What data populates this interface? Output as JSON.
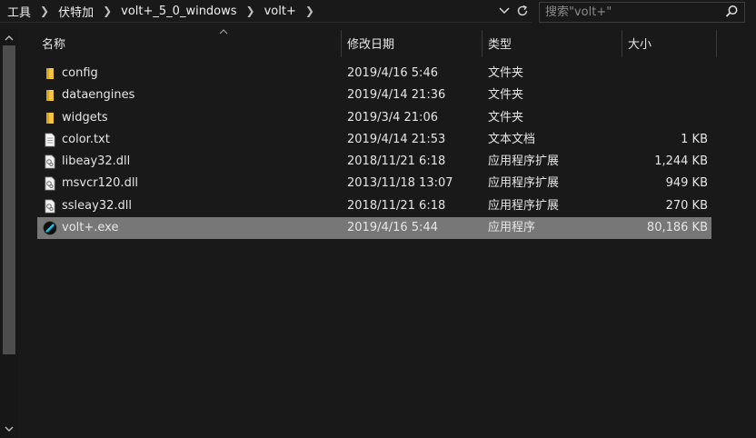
{
  "address": {
    "crumbs": [
      "工具",
      "伏特加",
      "volt+_5_0_windows",
      "volt+"
    ]
  },
  "search": {
    "placeholder": "搜索\"volt+\""
  },
  "columns": {
    "name": "名称",
    "date": "修改日期",
    "type": "类型",
    "size": "大小"
  },
  "files": [
    {
      "name": "config",
      "date": "2019/4/16 5:46",
      "type": "文件夹",
      "size": "",
      "icon": "folder-icon"
    },
    {
      "name": "dataengines",
      "date": "2019/4/14 21:36",
      "type": "文件夹",
      "size": "",
      "icon": "folder-icon"
    },
    {
      "name": "widgets",
      "date": "2019/3/4 21:06",
      "type": "文件夹",
      "size": "",
      "icon": "folder-icon"
    },
    {
      "name": "color.txt",
      "date": "2019/4/14 21:53",
      "type": "文本文档",
      "size": "1 KB",
      "icon": "text-file-icon"
    },
    {
      "name": "libeay32.dll",
      "date": "2018/11/21 6:18",
      "type": "应用程序扩展",
      "size": "1,244 KB",
      "icon": "dll-file-icon"
    },
    {
      "name": "msvcr120.dll",
      "date": "2013/11/18 13:07",
      "type": "应用程序扩展",
      "size": "949 KB",
      "icon": "dll-file-icon"
    },
    {
      "name": "ssleay32.dll",
      "date": "2018/11/21 6:18",
      "type": "应用程序扩展",
      "size": "270 KB",
      "icon": "dll-file-icon"
    },
    {
      "name": "volt+.exe",
      "date": "2019/4/16 5:44",
      "type": "应用程序",
      "size": "80,186 KB",
      "icon": "app-exe-icon",
      "selected": true
    }
  ],
  "colors": {
    "background": "#191919",
    "selected_row": "#777777",
    "folder": "#f4c542"
  }
}
